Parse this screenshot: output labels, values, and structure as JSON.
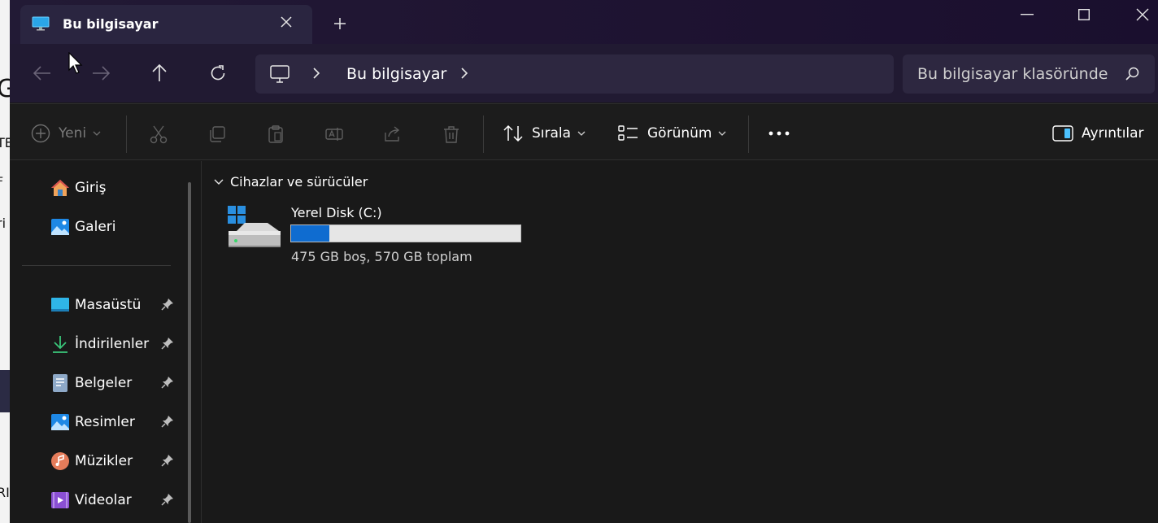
{
  "background_fragments": [
    "G",
    "TE",
    "F",
    "ri",
    "RI"
  ],
  "window": {
    "tab_title": "Bu bilgisayar",
    "tab_icon": "monitor-icon"
  },
  "address": {
    "crumbs": [
      "Bu bilgisayar"
    ],
    "search_placeholder": "Bu bilgisayar klasöründe"
  },
  "toolbar": {
    "new_label": "Yeni",
    "sort_label": "Sırala",
    "view_label": "Görünüm",
    "details_label": "Ayrıntılar"
  },
  "sidebar": {
    "top_items": [
      {
        "label": "Giriş",
        "icon": "home-icon"
      },
      {
        "label": "Galeri",
        "icon": "gallery-icon"
      }
    ],
    "quick_items": [
      {
        "label": "Masaüstü",
        "icon": "desktop-icon"
      },
      {
        "label": "İndirilenler",
        "icon": "downloads-icon"
      },
      {
        "label": "Belgeler",
        "icon": "documents-icon"
      },
      {
        "label": "Resimler",
        "icon": "pictures-icon"
      },
      {
        "label": "Müzikler",
        "icon": "music-icon"
      },
      {
        "label": "Videolar",
        "icon": "videos-icon"
      }
    ]
  },
  "main": {
    "group_title": "Cihazlar ve sürücüler",
    "drives": [
      {
        "name": "Yerel Disk (C:)",
        "info": "475 GB boş, 570 GB toplam",
        "used_fraction": 0.167
      }
    ]
  },
  "colors": {
    "accent": "#0f6cd0",
    "titlebar": "#1f1432",
    "panel": "#191919"
  }
}
